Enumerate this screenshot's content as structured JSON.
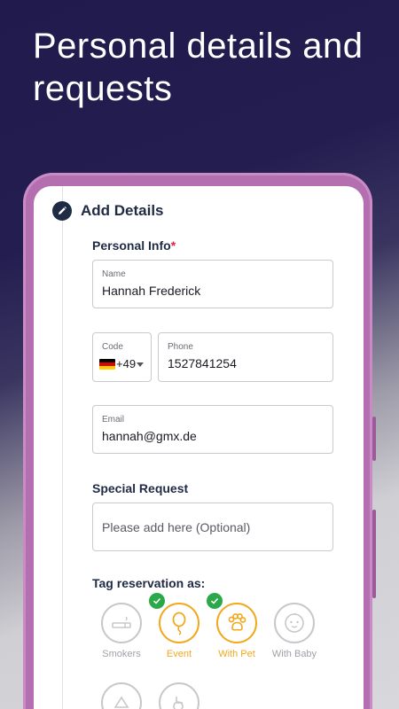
{
  "headline": "Personal details and requests",
  "section": {
    "title": "Add Details"
  },
  "personal_info": {
    "heading": "Personal Info",
    "required_marker": "*",
    "name": {
      "label": "Name",
      "value": "Hannah Frederick"
    },
    "code": {
      "label": "Code",
      "value": "+49",
      "flag": "germany-flag"
    },
    "phone": {
      "label": "Phone",
      "value": "1527841254"
    },
    "email": {
      "label": "Email",
      "value": "hannah@gmx.de"
    }
  },
  "special_request": {
    "heading": "Special Request",
    "placeholder": "Please add here (Optional)"
  },
  "tags": {
    "heading": "Tag reservation as:",
    "items": [
      {
        "label": "Smokers",
        "icon": "cigarette-icon",
        "selected": false
      },
      {
        "label": "Event",
        "icon": "balloon-icon",
        "selected": true
      },
      {
        "label": "With Pet",
        "icon": "paw-icon",
        "selected": true
      },
      {
        "label": "With Baby",
        "icon": "baby-icon",
        "selected": false
      }
    ]
  },
  "colors": {
    "accent": "#f2a81d",
    "check": "#2aa84a",
    "navy": "#1f2a44",
    "frame": "#b36fb0",
    "required": "#d7263d"
  }
}
